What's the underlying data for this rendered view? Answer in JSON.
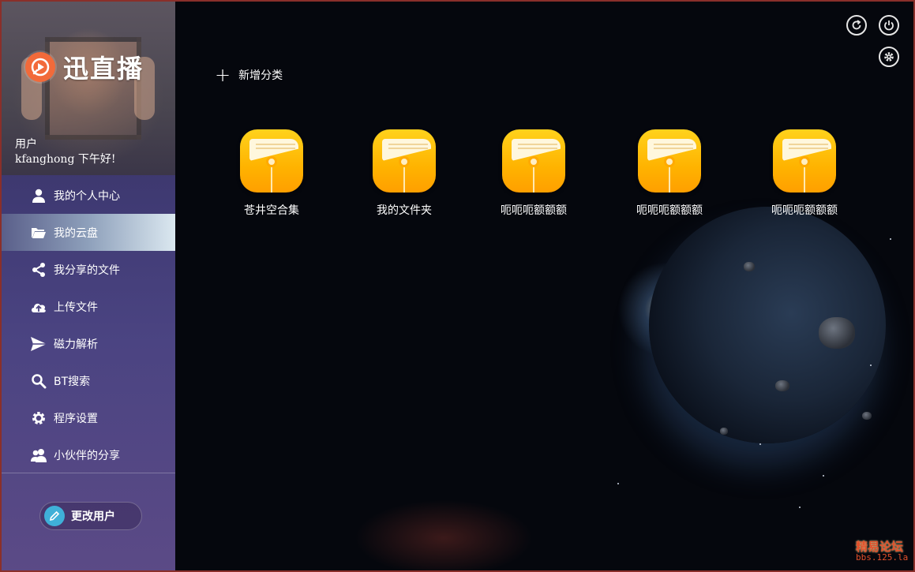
{
  "app": {
    "logo_text": "迅直播",
    "colors": {
      "accent": "#f26a3a",
      "folder": "#ffb300",
      "sidebar": "#4b4482",
      "main_bg": "#05070d"
    }
  },
  "profile": {
    "label": "用户",
    "greeting": "kfanghong  下午好!"
  },
  "sidebar": {
    "items": [
      {
        "label": "我的个人中心",
        "icon": "user-icon",
        "active": false
      },
      {
        "label": "我的云盘",
        "icon": "folder-open-icon",
        "active": true
      },
      {
        "label": "我分享的文件",
        "icon": "share-icon",
        "active": false
      },
      {
        "label": "上传文件",
        "icon": "cloud-upload-icon",
        "active": false
      },
      {
        "label": "磁力解析",
        "icon": "paper-plane-icon",
        "active": false
      },
      {
        "label": "BT搜索",
        "icon": "search-icon",
        "active": false
      },
      {
        "label": "程序设置",
        "icon": "gear-icon",
        "active": false
      },
      {
        "label": "小伙伴的分享",
        "icon": "friends-icon",
        "active": false
      }
    ],
    "change_user_label": "更改用户"
  },
  "toolbar": {
    "refresh_icon": "refresh-icon",
    "power_icon": "power-icon",
    "settings_icon": "gear-icon"
  },
  "main": {
    "add_category_label": "新增分类",
    "folders": [
      {
        "label": "苍井空合集"
      },
      {
        "label": "我的文件夹"
      },
      {
        "label": "呃呃呃额额额"
      },
      {
        "label": "呃呃呃额额额"
      },
      {
        "label": "呃呃呃额额额"
      }
    ]
  },
  "watermark": {
    "line1": "精易论坛",
    "line2": "bbs.125.la"
  }
}
